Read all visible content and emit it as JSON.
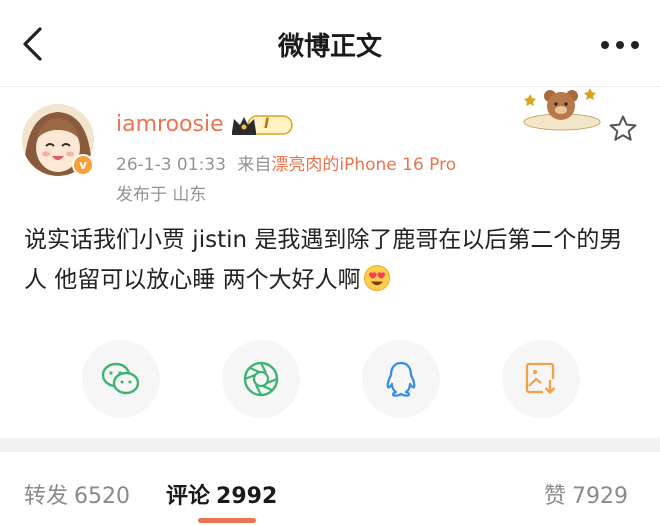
{
  "header": {
    "title": "微博正文"
  },
  "post": {
    "username": "iamroosie",
    "level_badge": "I",
    "avatar_badge": "v",
    "timestamp": "26-1-3 01:33",
    "source_prefix": "来自",
    "source": "漂亮肉的iPhone 16 Pro",
    "location": "发布于 山东",
    "text": "说实话我们小贾 jistin 是我遇到除了鹿哥在以后第二个的男人 他留可以放心睡 两个大好人啊"
  },
  "share": {
    "buttons": [
      "wechat",
      "moments",
      "qq",
      "save-image"
    ]
  },
  "tabs": {
    "repost_label": "转发",
    "repost_count": "6520",
    "comment_label": "评论",
    "comment_count": "2992",
    "like_label": "赞",
    "like_count": "7929"
  },
  "colors": {
    "accent": "#eb7350",
    "share_green": "#3cb371",
    "qq_blue": "#3a8ee6",
    "save_orange": "#f0a24a"
  },
  "icons": {
    "back": "chevron-left-icon",
    "more": "more-dots-icon",
    "favorite": "star-icon"
  }
}
